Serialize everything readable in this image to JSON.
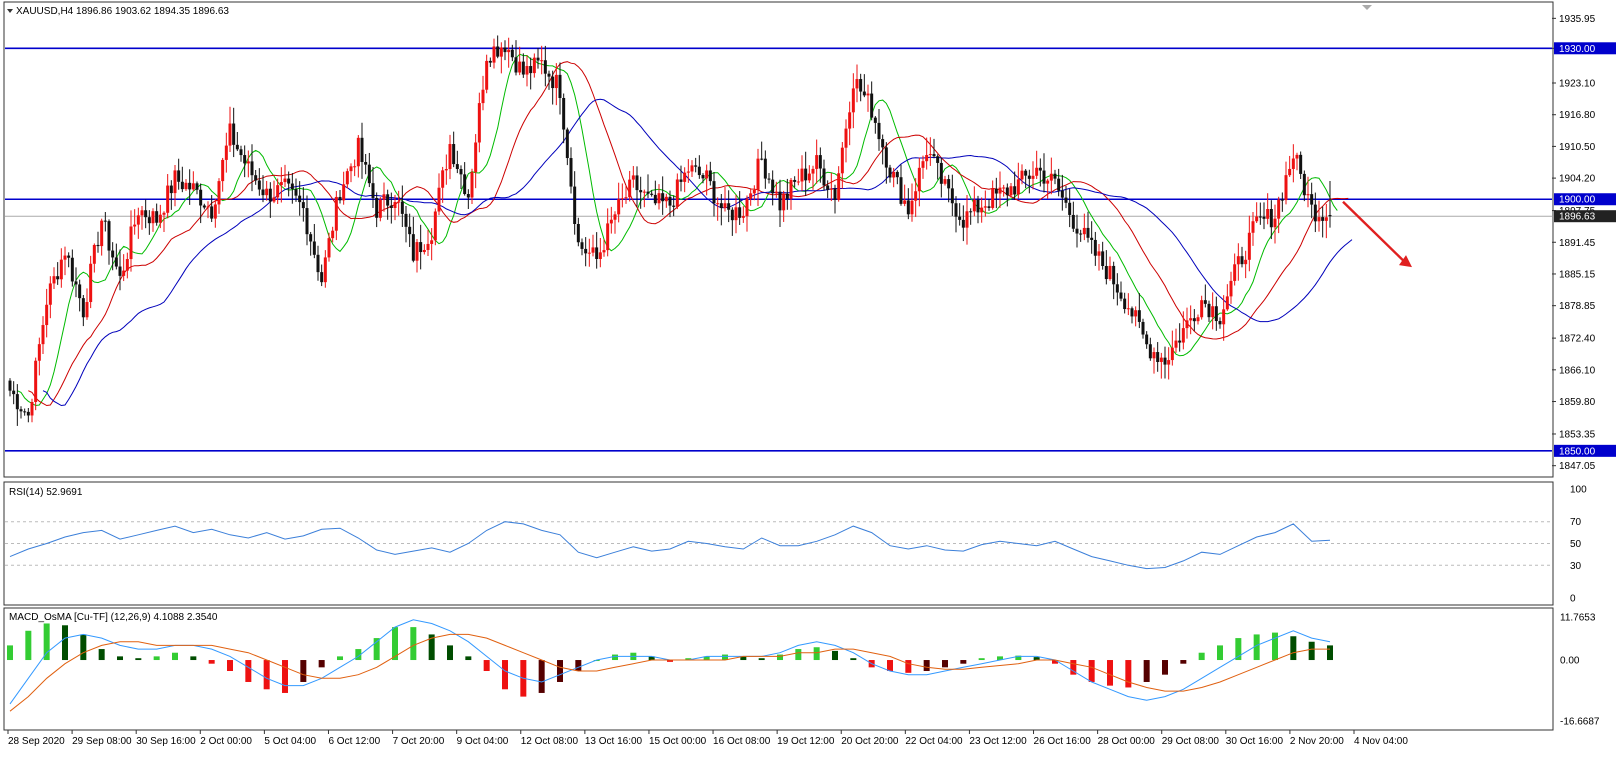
{
  "main_title": "XAUUSD,H4  1896.86 1903.62 1894.35 1896.63",
  "rsi_title": "RSI(14) 52.9691",
  "macd_title": "MACD_OsMA [Cu-TF] (12,26,9) 4.1088 2.3540",
  "chart_data": [
    {
      "type": "candlestick",
      "symbol": "XAUUSD",
      "timeframe": "H4",
      "ohlc_current": [
        1896.86,
        1903.62,
        1894.35,
        1896.63
      ],
      "y_ticks": [
        "1935.95",
        "1930.00",
        "1923.10",
        "1916.80",
        "1910.50",
        "1904.20",
        "1897.75",
        "1891.45",
        "1885.15",
        "1878.85",
        "1872.40",
        "1866.10",
        "1859.80",
        "1853.35",
        "1847.05"
      ],
      "ylim": [
        1845.0,
        1939.0
      ],
      "x_labels": [
        "28 Sep 2020",
        "29 Sep 08:00",
        "30 Sep 16:00",
        "2 Oct 00:00",
        "5 Oct 04:00",
        "6 Oct 12:00",
        "7 Oct 20:00",
        "9 Oct 04:00",
        "12 Oct 08:00",
        "13 Oct 16:00",
        "15 Oct 00:00",
        "16 Oct 08:00",
        "19 Oct 12:00",
        "20 Oct 20:00",
        "22 Oct 04:00",
        "23 Oct 12:00",
        "26 Oct 16:00",
        "28 Oct 00:00",
        "29 Oct 08:00",
        "30 Oct 16:00",
        "2 Nov 20:00",
        "4 Nov 04:00"
      ],
      "levels": [
        {
          "label": "1930.00",
          "value": 1930.0,
          "color": "#0000cc"
        },
        {
          "label": "1900.00",
          "value": 1900.0,
          "color": "#0000cc"
        },
        {
          "label": "1850.00",
          "value": 1850.0,
          "color": "#0000cc"
        }
      ],
      "current_price": {
        "label": "1896.63",
        "value": 1896.63
      },
      "bull_color": "#ee1111",
      "bear_color": "#111111",
      "ma_colors": [
        "#00bb00",
        "#cc0000",
        "#0000bb"
      ],
      "arrow_color": "#e02020",
      "anchors": [
        1862,
        1857,
        1880,
        1890,
        1878,
        1896,
        1884,
        1898,
        1896,
        1904,
        1902,
        1898,
        1913,
        1906,
        1901,
        1902,
        1898,
        1884,
        1902,
        1910,
        1898,
        1901,
        1889,
        1894,
        1911,
        1901,
        1929,
        1931,
        1925,
        1927,
        1922,
        1891,
        1888,
        1897,
        1903,
        1899,
        1899,
        1906,
        1904,
        1897,
        1898,
        1908,
        1899,
        1904,
        1907,
        1901,
        1924,
        1918,
        1906,
        1898,
        1910,
        1902,
        1896,
        1899,
        1901,
        1903,
        1906,
        1903,
        1896,
        1890,
        1885,
        1879,
        1871,
        1868,
        1874,
        1880,
        1877,
        1887,
        1895,
        1897,
        1909,
        1898,
        1897
      ],
      "points_per_segment": 5,
      "grid": false,
      "legend": "none"
    },
    {
      "type": "line",
      "indicator": "RSI(14)",
      "value": 52.9691,
      "y_ticks": [
        "100",
        "70",
        "50",
        "30",
        "0"
      ],
      "ylim": [
        0,
        100
      ],
      "levels": [
        70,
        50,
        30
      ],
      "line_color": "#3b7fd9",
      "values": [
        38,
        45,
        50,
        56,
        60,
        62,
        54,
        58,
        62,
        66,
        60,
        63,
        58,
        55,
        60,
        54,
        57,
        63,
        64,
        55,
        44,
        40,
        43,
        46,
        42,
        50,
        62,
        70,
        68,
        62,
        58,
        42,
        37,
        42,
        47,
        43,
        45,
        52,
        50,
        47,
        45,
        55,
        48,
        48,
        52,
        58,
        66,
        60,
        48,
        45,
        48,
        44,
        43,
        49,
        52,
        50,
        48,
        52,
        45,
        38,
        34,
        30,
        27,
        28,
        34,
        42,
        40,
        48,
        56,
        60,
        68,
        52,
        53
      ]
    },
    {
      "type": "bar",
      "indicator": "MACD_OsMA [Cu-TF] (12,26,9)",
      "values_shown": [
        4.1088,
        2.354
      ],
      "y_ticks": [
        "11.7653",
        "0.00",
        "-16.6687"
      ],
      "ylim": [
        -16.6687,
        11.7653
      ],
      "pos_up_color": "#33cc33",
      "pos_down_color": "#004d00",
      "neg_down_color": "#ee1111",
      "neg_up_color": "#550000",
      "macd_color": "#3399ff",
      "signal_color": "#e06010",
      "osma": [
        4,
        8,
        10,
        9.5,
        7,
        3,
        1,
        0.5,
        1,
        2,
        1,
        -1,
        -3,
        -6,
        -8,
        -9,
        -6,
        -2,
        1,
        3,
        6,
        9,
        9,
        7,
        4,
        1,
        -3,
        -8,
        -10,
        -9,
        -6,
        -3,
        0,
        1.5,
        2,
        1,
        -0.5,
        0.5,
        1,
        1.5,
        1,
        0.5,
        1.5,
        3,
        3.5,
        2.5,
        0.5,
        -2,
        -3,
        -3.5,
        -3,
        -2,
        -1,
        0.5,
        1,
        1.2,
        0.8,
        -1,
        -4,
        -6,
        -7,
        -7.5,
        -6,
        -4,
        -1,
        2,
        4,
        6,
        7,
        7.5,
        6.5,
        5,
        4
      ],
      "macd": [
        -12,
        -5,
        2,
        6,
        7,
        6,
        4,
        3,
        3,
        4,
        4,
        3,
        1,
        -2,
        -5,
        -7,
        -7,
        -5,
        -2,
        1,
        5,
        9,
        11,
        10,
        8,
        5,
        1,
        -3,
        -5,
        -6,
        -4,
        -2,
        0,
        1,
        1,
        1,
        0,
        0,
        1,
        1,
        1,
        1,
        2,
        4,
        5,
        4,
        2,
        -1,
        -3,
        -4,
        -4,
        -3,
        -2,
        -1,
        0,
        1,
        1,
        0,
        -3,
        -6,
        -8,
        -10,
        -11,
        -10,
        -8,
        -5,
        -2,
        1,
        4,
        6,
        8,
        6,
        5
      ],
      "signal": [
        -14,
        -10,
        -5,
        -1,
        2,
        4,
        5,
        5,
        4,
        4,
        4,
        4,
        3,
        2,
        0,
        -2,
        -4,
        -5,
        -5,
        -4,
        -2,
        1,
        4,
        6,
        7,
        7,
        6,
        4,
        2,
        0,
        -2,
        -3,
        -3,
        -2,
        -1,
        0,
        0,
        0,
        0,
        0,
        1,
        1,
        1,
        2,
        2,
        3,
        3,
        2,
        1,
        -1,
        -2,
        -2.5,
        -2.5,
        -2,
        -1.5,
        -1,
        0,
        0,
        -1,
        -2,
        -4,
        -6,
        -7.5,
        -8.5,
        -8.5,
        -7.5,
        -6,
        -4,
        -2,
        0,
        2,
        3,
        3
      ]
    }
  ]
}
